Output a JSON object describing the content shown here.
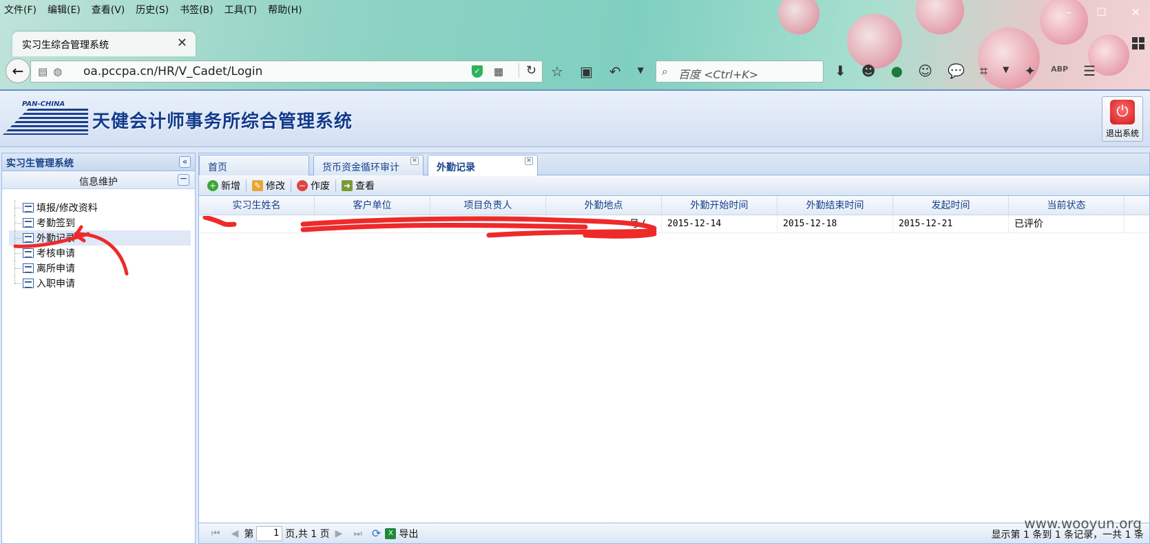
{
  "browser": {
    "menu": [
      "文件(F)",
      "编辑(E)",
      "查看(V)",
      "历史(S)",
      "书签(B)",
      "工具(T)",
      "帮助(H)"
    ],
    "tab_title": "实习生综合管理系统",
    "url": "oa.pccpa.cn/HR/V_Cadet/Login",
    "search_placeholder": "百度 <Ctrl+K>",
    "abp_label": "ABP"
  },
  "header": {
    "logo_text": "PAN-CHINA",
    "title": "天健会计师事务所综合管理系统",
    "logout_label": "退出系统"
  },
  "west": {
    "title": "实习生管理系统",
    "section": "信息维护",
    "items": [
      "填报/修改资料",
      "考勤签到",
      "外勤记录",
      "考核申请",
      "离所申请",
      "入职申请"
    ],
    "selected_index": 2
  },
  "tabs": [
    {
      "label": "首页",
      "closable": false,
      "active": false
    },
    {
      "label": "货币资金循环审计",
      "closable": true,
      "active": false
    },
    {
      "label": "外勤记录",
      "closable": true,
      "active": true
    }
  ],
  "toolbar": {
    "add": "新增",
    "edit": "修改",
    "void": "作废",
    "view": "查看"
  },
  "grid": {
    "columns": [
      "实习生姓名",
      "客户单位",
      "项目负责人",
      "外勤地点",
      "外勤开始时间",
      "外勤结束时间",
      "发起时间",
      "当前状态"
    ],
    "rows": [
      {
        "name": "",
        "client": "",
        "manager": "",
        "location": "号 (…",
        "start": "2015-12-14",
        "end": "2015-12-18",
        "created": "2015-12-21",
        "status": "已评价"
      }
    ]
  },
  "pager": {
    "page_prefix": "第",
    "page_value": "1",
    "page_suffix": "页,共 1 页",
    "export": "导出",
    "info": "显示第 1 条到 1 条记录，一共 1 条"
  },
  "watermark": "www.wooyun.org",
  "colors": {
    "accent": "#15428b",
    "panel_border": "#99bbe8",
    "annotation": "#ee2a2a"
  }
}
